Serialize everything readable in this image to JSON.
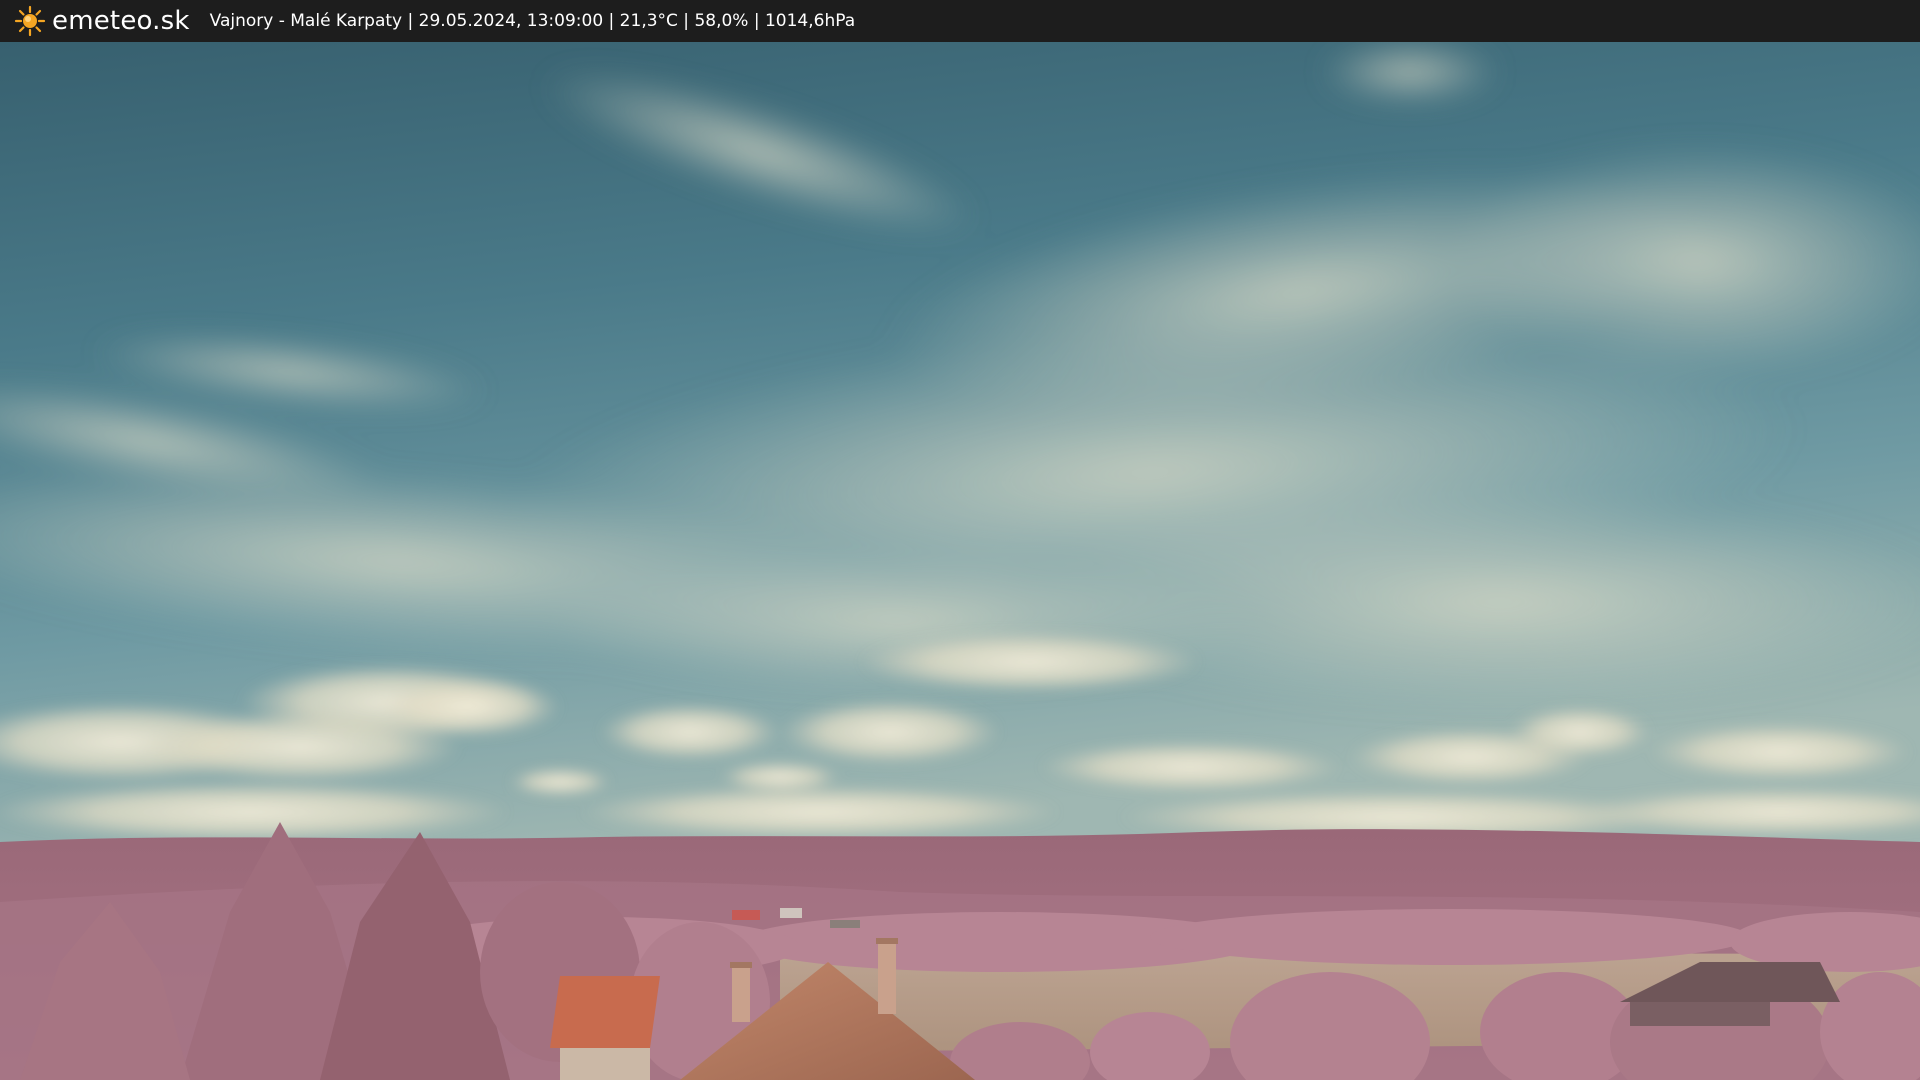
{
  "header": {
    "logo_text": "emeteo.sk",
    "logo_icon": "sun-icon",
    "caption": "Vajnory - Malé Karpaty | 29.05.2024, 13:09:00 | 21,3°C | 58,0% | 1014,6hPa"
  },
  "colors": {
    "bar": "#1d1d1d",
    "sun": "#f5a623",
    "sky_top": "#3e6a7a",
    "sky_mid": "#5d8d9b",
    "cloud": "#e6e1cc",
    "hills": "#a0707f",
    "foliage": "#b98796",
    "field": "#b99f8c",
    "roof": "#c56a4d"
  }
}
